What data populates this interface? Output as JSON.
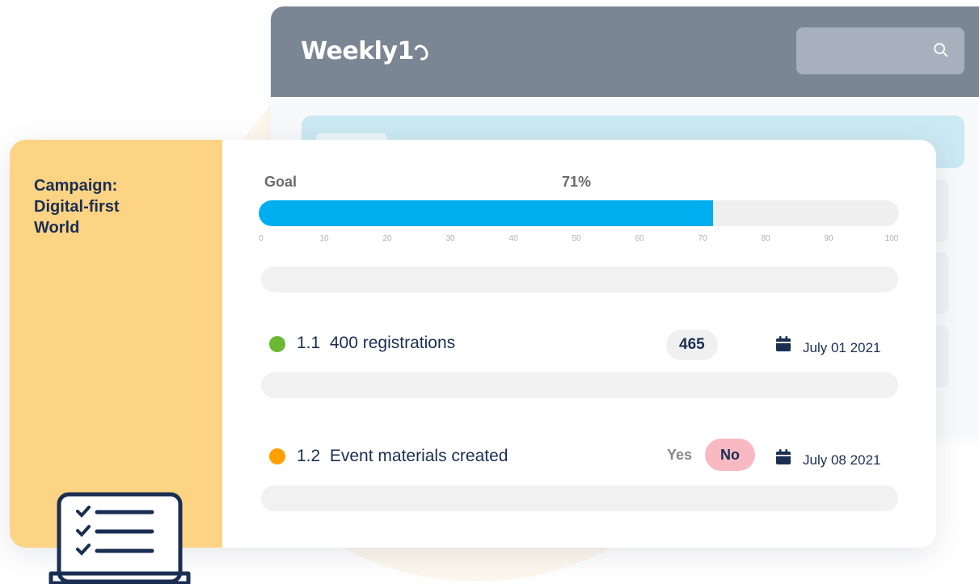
{
  "app": {
    "logo": "Weekly1",
    "search_icon": "search-icon"
  },
  "campaign": {
    "title": "Campaign:\nDigital-first\nWorld"
  },
  "goal": {
    "label": "Goal",
    "percent_text": "71%",
    "progress": 71,
    "ticks": [
      "0",
      "10",
      "20",
      "30",
      "40",
      "50",
      "60",
      "70",
      "80",
      "90",
      "100"
    ]
  },
  "key_results": [
    {
      "number": "1.1",
      "title": "400 registrations",
      "status_color": "#6bb833",
      "value": "465",
      "date": "July 01 2021",
      "date_icon": "calendar-icon"
    },
    {
      "number": "1.2",
      "title": "Event materials created",
      "status_color": "#ff9f00",
      "yes_label": "Yes",
      "no_label": "No",
      "selected": "No",
      "date": "July 08 2021",
      "date_icon": "calendar-icon"
    }
  ],
  "colors": {
    "header": "#7b8694",
    "sidebar": "#fdd384",
    "progress": "#00aeef",
    "no_pill": "#f8b9c2",
    "text_dark": "#1a2e52"
  },
  "decorations": {
    "illustration": "laptop-checklist-icon"
  }
}
